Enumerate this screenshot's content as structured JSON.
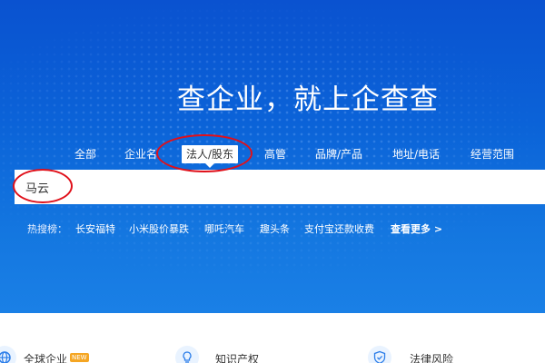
{
  "hero": {
    "slogan": "查企业，就上企查查"
  },
  "tabs": [
    {
      "label": "全部"
    },
    {
      "label": "企业名"
    },
    {
      "label": "法人/股东"
    },
    {
      "label": "高管"
    },
    {
      "label": "品牌/产品"
    },
    {
      "label": "地址/电话"
    },
    {
      "label": "经营范围"
    }
  ],
  "active_tab_index": 2,
  "search": {
    "value": "马云",
    "placeholder": ""
  },
  "hot_search": {
    "label": "热搜榜：",
    "items": [
      "长安福特",
      "小米股价暴跌",
      "哪吒汽车",
      "趣头条",
      "支付宝还款收费"
    ],
    "more": "查看更多 >"
  },
  "features": [
    {
      "label": "全球企业",
      "badge": "NEW",
      "icon": "globe-icon"
    },
    {
      "label": "知识产权",
      "icon": "lightbulb-icon"
    },
    {
      "label": "法律风险",
      "icon": "shield-icon"
    }
  ],
  "colors": {
    "hero_top": "#0a52d0",
    "hero_bottom": "#1a80e6",
    "annotation": "#e0101a",
    "badge": "#f5a623"
  }
}
